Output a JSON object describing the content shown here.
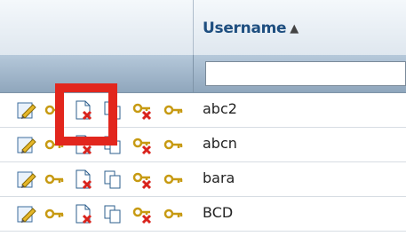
{
  "grid": {
    "columns": [
      {
        "label": "",
        "sort": ""
      },
      {
        "label": "Username",
        "sort": "ascending"
      }
    ],
    "filter": {
      "value": "",
      "placeholder": ""
    },
    "rows": [
      {
        "username": "abc2"
      },
      {
        "username": "abcn"
      },
      {
        "username": "bara"
      },
      {
        "username": "BCD"
      }
    ],
    "action_icons": [
      "edit-icon",
      "key-icon",
      "delete-document-icon",
      "copy-document-icon",
      "delete-key-icon",
      "key-icon"
    ]
  },
  "highlight": {
    "color": "#e2261d",
    "target": "delete-document-icon"
  }
}
